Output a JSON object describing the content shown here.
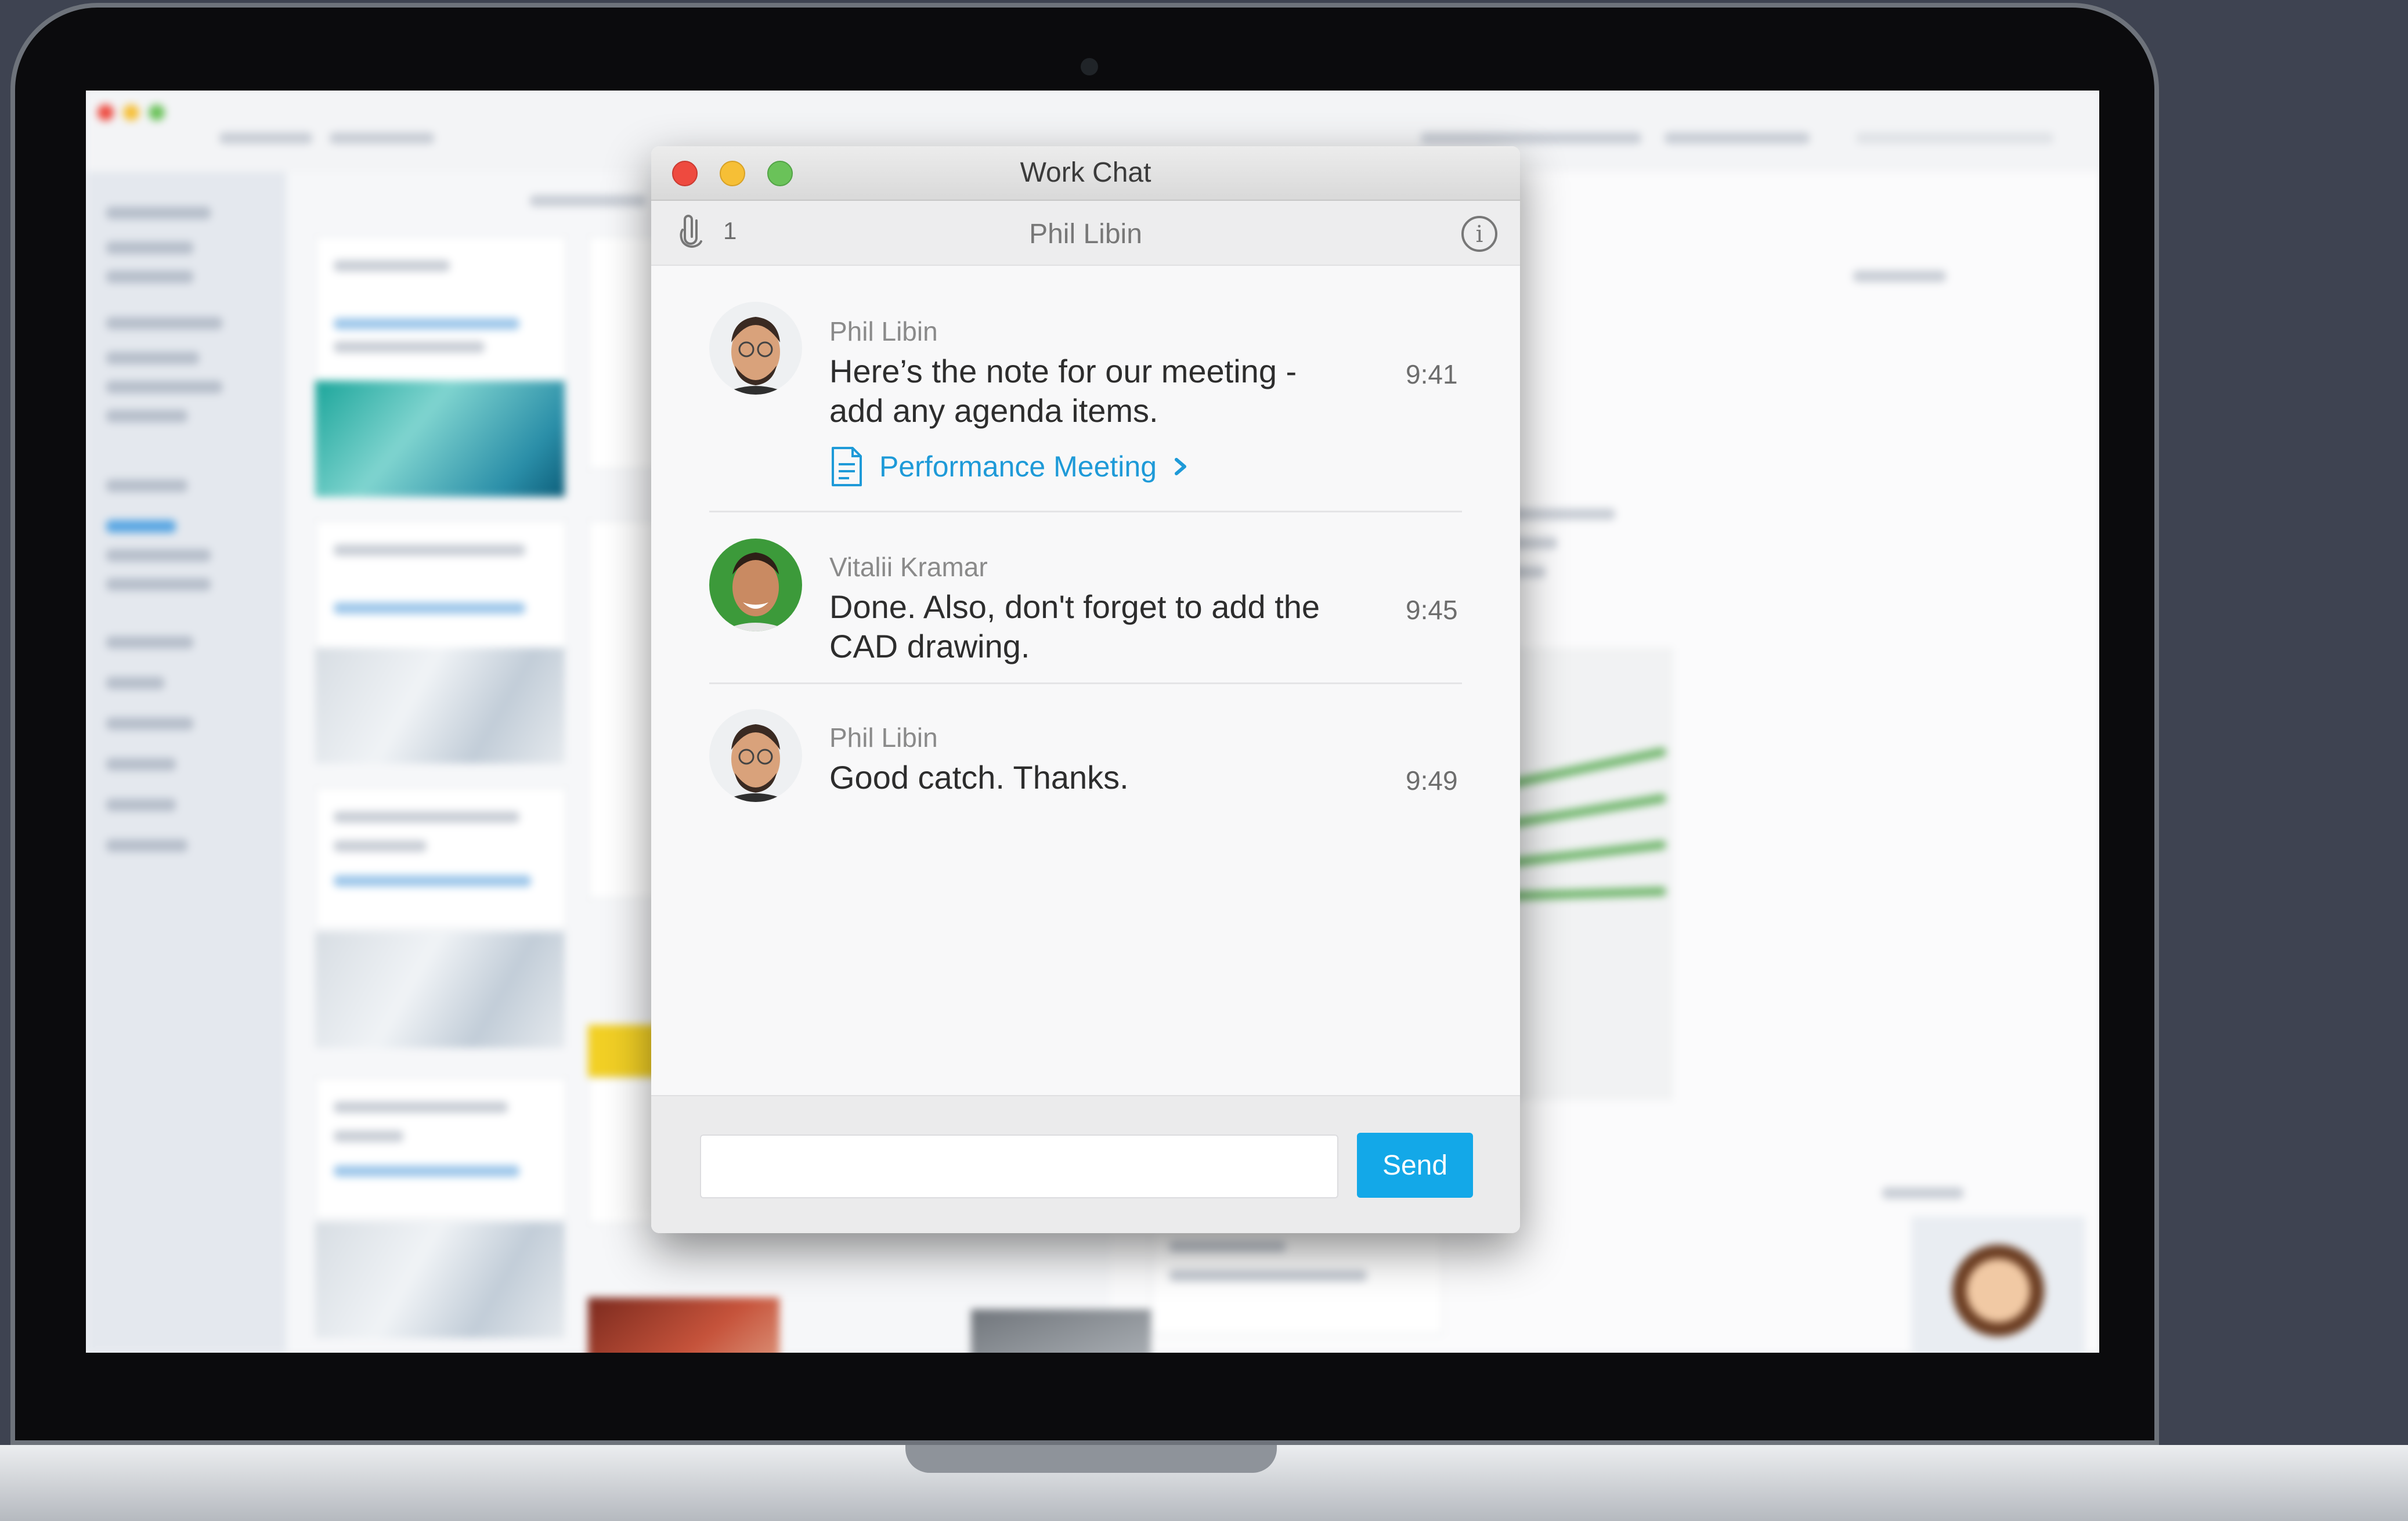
{
  "chat": {
    "window_title": "Work Chat",
    "participant_name": "Phil Libin",
    "participant_count": "1",
    "messages": [
      {
        "sender": "Phil Libin",
        "text": "Here’s the note for our meeting - add any agenda items.",
        "time": "9:41",
        "attachment": {
          "label": "Performance Meeting",
          "icon": "note-icon"
        }
      },
      {
        "sender": "Vitalii Kramar",
        "text": "Done. Also, don't forget to add the CAD drawing.",
        "time": "9:45"
      },
      {
        "sender": "Phil Libin",
        "text": "Good catch. Thanks.",
        "time": "9:49"
      }
    ],
    "composer": {
      "placeholder": "",
      "send_label": "Send"
    }
  },
  "colors": {
    "accent": "#13a8e8",
    "link": "#1e9ad8",
    "close": "#ee4a3f",
    "minimize": "#f6bf36",
    "zoom": "#6ac259"
  },
  "icons": [
    "paperclip-icon",
    "info-icon",
    "note-icon",
    "chevron-right-icon"
  ]
}
